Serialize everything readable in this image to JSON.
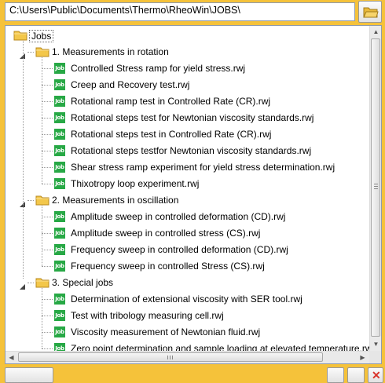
{
  "path": {
    "value": "C:\\Users\\Public\\Documents\\Thermo\\RheoWin\\JOBS\\"
  },
  "tree": {
    "root": {
      "label": "Jobs"
    },
    "icon_text": "Job",
    "groups": [
      {
        "label": "1. Measurements in rotation",
        "items": [
          "Controlled Stress ramp for yield stress.rwj",
          "Creep and Recovery test.rwj",
          "Rotational ramp test in Controlled Rate (CR).rwj",
          "Rotational steps test for Newtonian viscosity standards.rwj",
          "Rotational steps test in Controlled Rate (CR).rwj",
          "Rotational steps testfor Newtonian viscosity standards.rwj",
          "Shear stress ramp experiment for yield stress determination.rwj",
          "Thixotropy loop experiment.rwj"
        ]
      },
      {
        "label": "2. Measurements in oscillation",
        "items": [
          "Amplitude sweep in controlled deformation (CD).rwj",
          "Amplitude sweep in controlled stress (CS).rwj",
          "Frequency sweep in controlled deformation (CD).rwj",
          "Frequency sweep in controlled Stress (CS).rwj"
        ]
      },
      {
        "label": "3. Special jobs",
        "items": [
          "Determination of extensional viscosity with SER tool.rwj",
          "Test with tribology measuring cell.rwj",
          "Viscosity measurement of Newtonian fluid.rwj",
          "Zero point determination and sample loading at elevated temperature.rwj"
        ]
      }
    ]
  },
  "icons": {
    "folder": "folder-icon",
    "job": "job-file-icon",
    "browse": "open-folder-icon"
  },
  "colors": {
    "background": "#f5c23a",
    "job_icon": "#27a845",
    "folder": "#f3c74a"
  }
}
